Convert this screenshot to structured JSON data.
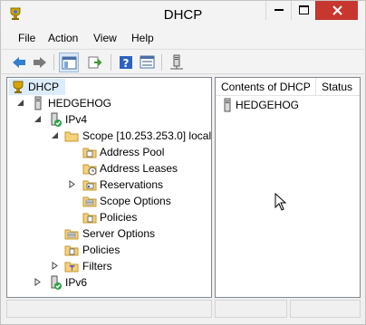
{
  "window": {
    "title": "DHCP"
  },
  "menu": [
    "File",
    "Action",
    "View",
    "Help"
  ],
  "toolbar": {
    "buttons": [
      "back-icon",
      "forward-icon",
      "show-hide-console-tree-icon",
      "export-list-icon",
      "help-icon",
      "properties-icon",
      "server-icon"
    ]
  },
  "tree": {
    "root": "DHCP",
    "server": "HEDGEHOG",
    "ipv4": "IPv4",
    "scope": "Scope [10.253.253.0] local",
    "address_pool": "Address Pool",
    "address_leases": "Address Leases",
    "reservations": "Reservations",
    "scope_options": "Scope Options",
    "scope_policies": "Policies",
    "server_options": "Server Options",
    "policies": "Policies",
    "filters": "Filters",
    "ipv6": "IPv6"
  },
  "list": {
    "columns": [
      "Contents of DHCP",
      "Status"
    ],
    "rows": [
      "HEDGEHOG"
    ]
  },
  "colors": {
    "selection": "#ddecfc",
    "close": "#c7372f"
  }
}
